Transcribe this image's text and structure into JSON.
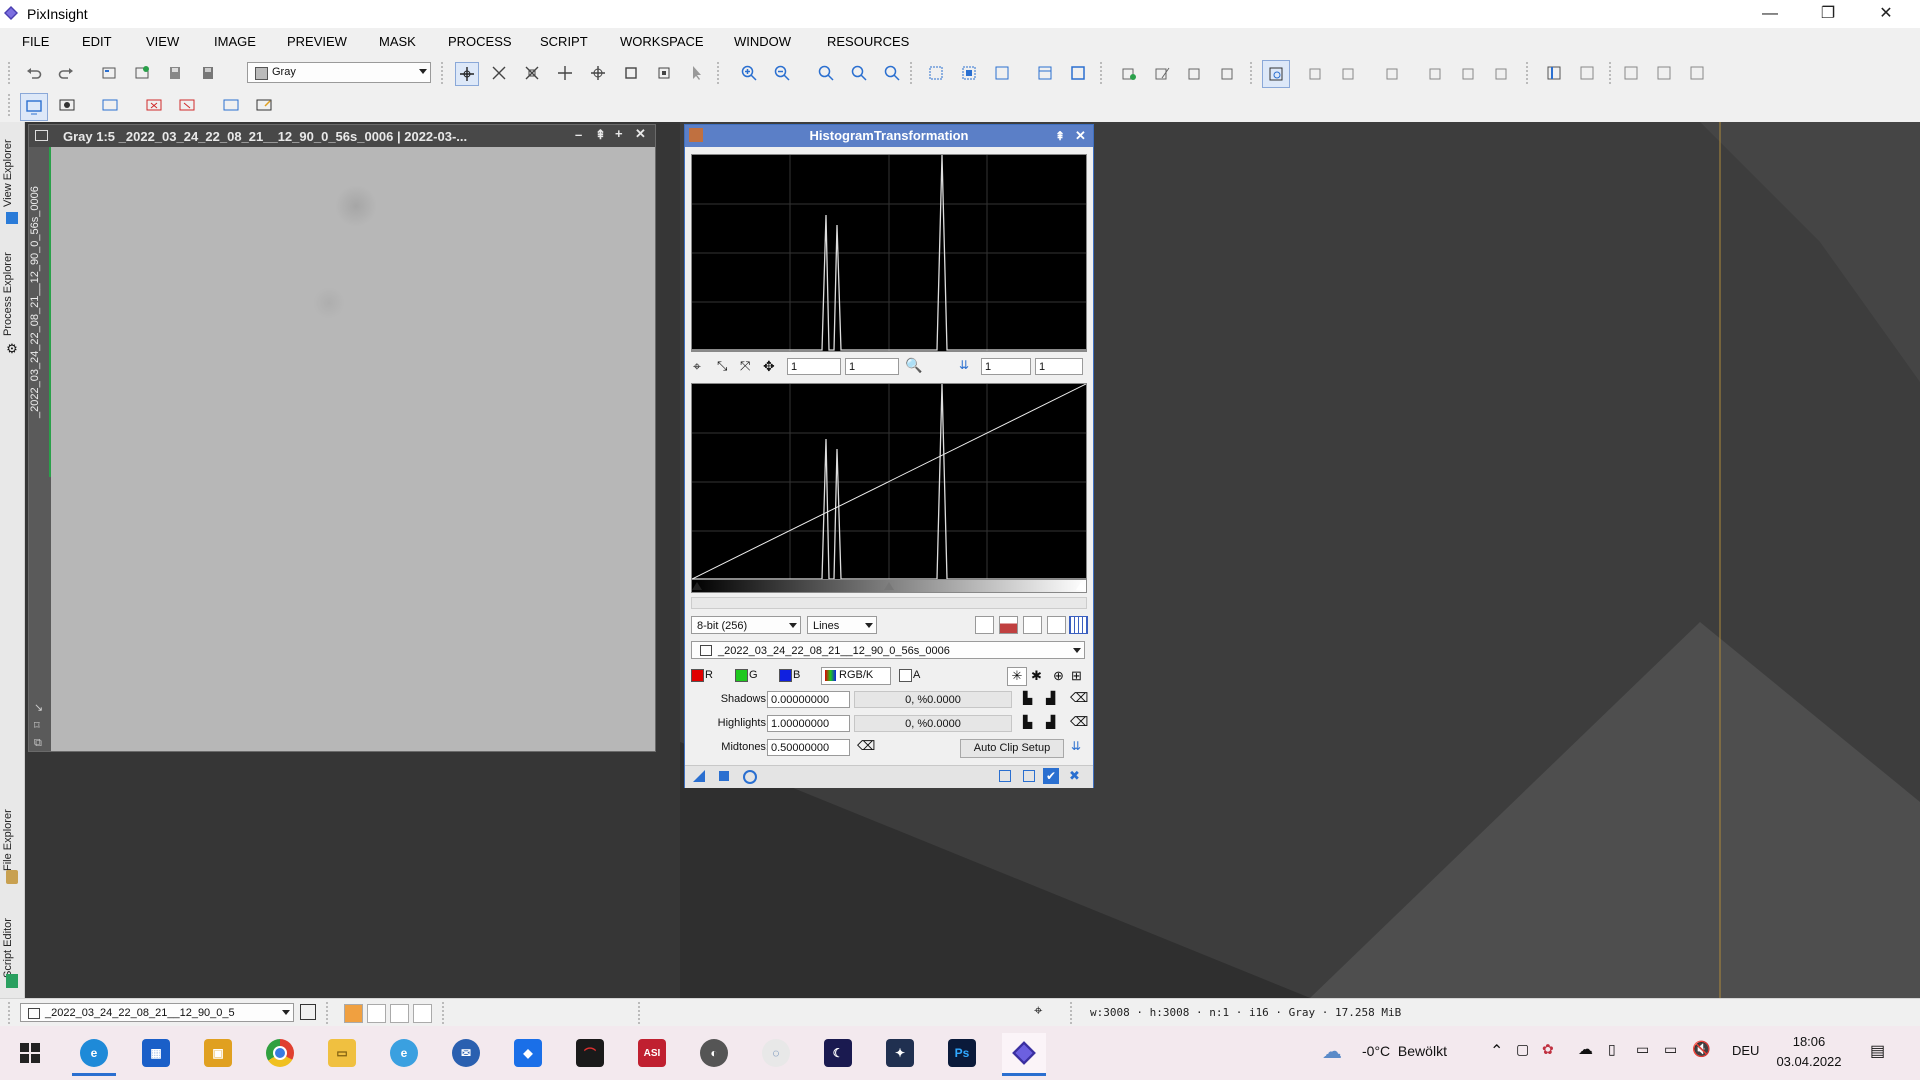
{
  "app": {
    "title": "PixInsight"
  },
  "window_controls": {
    "minimize": "—",
    "restore": "❐",
    "close": "✕"
  },
  "menu": [
    "FILE",
    "EDIT",
    "VIEW",
    "IMAGE",
    "PREVIEW",
    "MASK",
    "PROCESS",
    "SCRIPT",
    "WORKSPACE",
    "WINDOW",
    "RESOURCES"
  ],
  "toolbar": {
    "color_space_select": "Gray"
  },
  "sidebar_tabs": {
    "view_explorer": "View Explorer",
    "image_tab": "_2022_03_24_22_08_21__12_90_0_56s_0006",
    "process_explorer": "Process Explorer",
    "file_explorer": "File Explorer",
    "script_editor": "Script Editor"
  },
  "image_window": {
    "title": "Gray 1:5 _2022_03_24_22_08_21__12_90_0_56s_0006 | 2022-03-..."
  },
  "histogram": {
    "title": "HistogramTransformation",
    "zoom_h1": "1",
    "zoom_v1": "1",
    "zoom_h2": "1",
    "zoom_v2": "1",
    "resolution": "8-bit (256)",
    "graph_style": "Lines",
    "target_view": "_2022_03_24_22_08_21__12_90_0_56s_0006",
    "channels": {
      "r": "R",
      "g": "G",
      "b": "B",
      "rgbk": "RGB/K",
      "a": "A"
    },
    "shadows_label": "Shadows:",
    "shadows_value": "0.00000000",
    "shadows_readout": "0, %0.0000",
    "highlights_label": "Highlights:",
    "highlights_value": "1.00000000",
    "highlights_readout": "0, %0.0000",
    "midtones_label": "Midtones:",
    "midtones_value": "0.50000000",
    "auto_clip_button": "Auto Clip Setup"
  },
  "statusbar": {
    "view_selector": "_2022_03_24_22_08_21__12_90_0_5",
    "info": "w:3008 · h:3008 · n:1 · i16 · Gray · 17.258 MiB"
  },
  "taskbar": {
    "weather": "-0°C  Bewölkt",
    "language": "DEU",
    "time": "18:06",
    "date": "03.04.2022",
    "apps": [
      "start-icon",
      "edge-icon",
      "store-icon",
      "app-icon",
      "chrome-icon",
      "explorer-icon",
      "ie-icon",
      "thunderbird-icon",
      "dropbox-icon",
      "app-icon",
      "asi-icon",
      "app-icon",
      "app-icon",
      "app-icon",
      "app-icon",
      "photoshop-icon",
      "pixinsight-icon"
    ]
  },
  "colors": {
    "accent": "#5b7fc7",
    "workspace": "#363636",
    "histogram_bg": "#000000"
  }
}
